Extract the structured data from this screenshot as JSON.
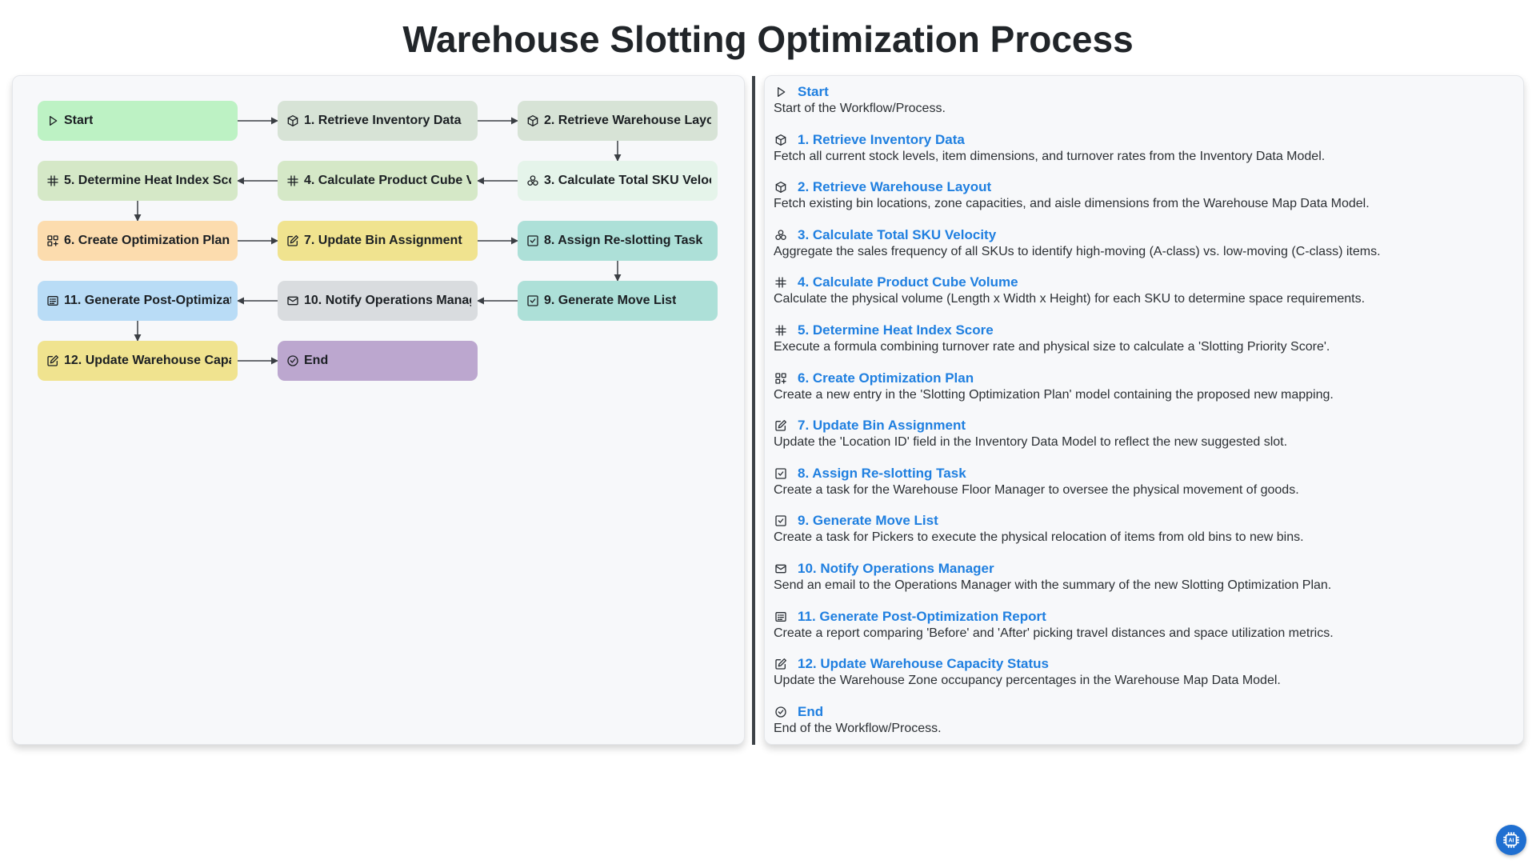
{
  "page": {
    "title": "Warehouse Slotting Optimization Process"
  },
  "nodes": [
    {
      "id": "start",
      "label": "Start",
      "icon": "play-icon",
      "color": "#bdf2c4"
    },
    {
      "id": "n1",
      "label": "1. Retrieve Inventory Data",
      "icon": "box-icon",
      "color": "#d7e3d6"
    },
    {
      "id": "n2",
      "label": "2. Retrieve Warehouse Layout",
      "icon": "box-icon",
      "color": "#d7e3d6"
    },
    {
      "id": "n3",
      "label": "3. Calculate Total SKU Velocity",
      "icon": "circles-icon",
      "color": "#e5f4ea"
    },
    {
      "id": "n4",
      "label": "4. Calculate Product Cube Volume",
      "icon": "hash-icon",
      "color": "#d5e8c7"
    },
    {
      "id": "n5",
      "label": "5. Determine Heat Index Score",
      "icon": "hash-icon",
      "color": "#d5e8c7"
    },
    {
      "id": "n6",
      "label": "6. Create Optimization Plan",
      "icon": "grid-plus-icon",
      "color": "#fcdcae"
    },
    {
      "id": "n7",
      "label": "7. Update Bin Assignment",
      "icon": "edit-icon",
      "color": "#f0e38f"
    },
    {
      "id": "n8",
      "label": "8. Assign Re-slotting Task",
      "icon": "check-square-icon",
      "color": "#ade0d8"
    },
    {
      "id": "n9",
      "label": "9. Generate Move List",
      "icon": "check-square-icon",
      "color": "#ade0d8"
    },
    {
      "id": "n10",
      "label": "10. Notify Operations Manager",
      "icon": "mail-icon",
      "color": "#d9dcdf"
    },
    {
      "id": "n11",
      "label": "11. Generate Post-Optimization Report",
      "icon": "report-icon",
      "color": "#b9dcf6"
    },
    {
      "id": "n12",
      "label": "12. Update Warehouse Capacity Status",
      "icon": "edit-icon",
      "color": "#f0e38f"
    },
    {
      "id": "end",
      "label": "End",
      "icon": "check-circle-icon",
      "color": "#bca7cf"
    }
  ],
  "legend": [
    {
      "title": "Start",
      "icon": "play-icon",
      "desc": "Start of the Workflow/Process."
    },
    {
      "title": "1. Retrieve Inventory Data",
      "icon": "box-icon",
      "desc": "Fetch all current stock levels, item dimensions, and turnover rates from the Inventory Data Model."
    },
    {
      "title": "2. Retrieve Warehouse Layout",
      "icon": "box-icon",
      "desc": "Fetch existing bin locations, zone capacities, and aisle dimensions from the Warehouse Map Data Model."
    },
    {
      "title": "3. Calculate Total SKU Velocity",
      "icon": "circles-icon",
      "desc": "Aggregate the sales frequency of all SKUs to identify high-moving (A-class) vs. low-moving (C-class) items."
    },
    {
      "title": "4. Calculate Product Cube Volume",
      "icon": "hash-icon",
      "desc": "Calculate the physical volume (Length x Width x Height) for each SKU to determine space requirements."
    },
    {
      "title": "5. Determine Heat Index Score",
      "icon": "hash-icon",
      "desc": "Execute a formula combining turnover rate and physical size to calculate a 'Slotting Priority Score'."
    },
    {
      "title": "6. Create Optimization Plan",
      "icon": "grid-plus-icon",
      "desc": "Create a new entry in the 'Slotting Optimization Plan' model containing the proposed new mapping."
    },
    {
      "title": "7. Update Bin Assignment",
      "icon": "edit-icon",
      "desc": "Update the 'Location ID' field in the Inventory Data Model to reflect the new suggested slot."
    },
    {
      "title": "8. Assign Re-slotting Task",
      "icon": "check-square-icon",
      "desc": "Create a task for the Warehouse Floor Manager to oversee the physical movement of goods."
    },
    {
      "title": "9. Generate Move List",
      "icon": "check-square-icon",
      "desc": "Create a task for Pickers to execute the physical relocation of items from old bins to new bins."
    },
    {
      "title": "10. Notify Operations Manager",
      "icon": "mail-icon",
      "desc": "Send an email to the Operations Manager with the summary of the new Slotting Optimization Plan."
    },
    {
      "title": "11. Generate Post-Optimization Report",
      "icon": "report-icon",
      "desc": "Create a report comparing 'Before' and 'After' picking travel distances and space utilization metrics."
    },
    {
      "title": "12. Update Warehouse Capacity Status",
      "icon": "edit-icon",
      "desc": "Update the Warehouse Zone occupancy percentages in the Warehouse Map Data Model."
    },
    {
      "title": "End",
      "icon": "check-circle-icon",
      "desc": "End of the Workflow/Process."
    }
  ],
  "badge": {
    "text": "AI",
    "icon": "ai-chip-icon"
  }
}
